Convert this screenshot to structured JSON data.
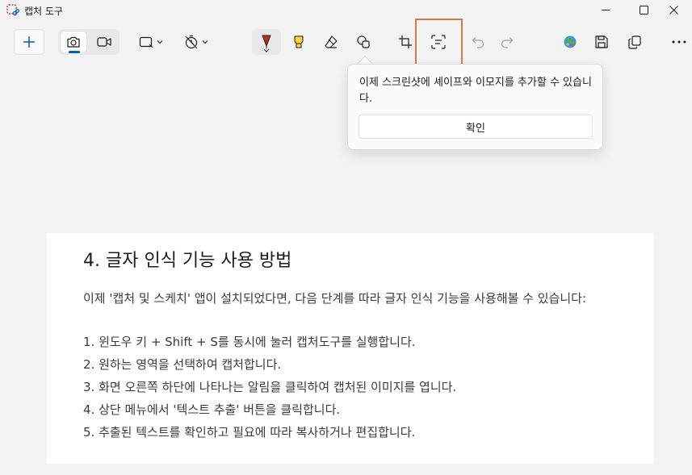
{
  "window": {
    "title": "캡처 도구"
  },
  "toolbar": {
    "buttons": [
      {
        "name": "new-icon"
      },
      {
        "name": "screenshot-mode-icon",
        "active": true
      },
      {
        "name": "video-mode-icon"
      },
      {
        "name": "rectangle-snip-icon"
      },
      {
        "name": "delay-timer-icon"
      },
      {
        "name": "ballpoint-pen-icon",
        "active": true
      },
      {
        "name": "highlighter-icon"
      },
      {
        "name": "eraser-icon"
      },
      {
        "name": "shapes-icon"
      },
      {
        "name": "crop-icon"
      },
      {
        "name": "text-actions-icon"
      },
      {
        "name": "undo-icon"
      },
      {
        "name": "redo-icon"
      },
      {
        "name": "paint-icon"
      },
      {
        "name": "save-icon"
      },
      {
        "name": "copy-icon"
      },
      {
        "name": "more-icon"
      }
    ],
    "highlight_color": "#d9774b",
    "accent_color": "#005fb8"
  },
  "popup": {
    "message": "이제 스크린샷에 셰이프와 이모지를 추가할 수 있습니다.",
    "confirm_label": "확인"
  },
  "document": {
    "title": "4. 글자 인식 기능 사용 방법",
    "intro": "이제 '캡처 및 스케치' 앱이 설치되었다면, 다음 단계를 따라 글자 인식 기능을 사용해볼 수 있습니다:",
    "steps": [
      "1. 윈도우 키 + Shift + S를 동시에 눌러 캡처도구를 실행합니다.",
      "2. 원하는 영역을 선택하여 캡처합니다.",
      "3. 화면 오른쪽 하단에 나타나는 알림을 클릭하여 캡처된 이미지를 엽니다.",
      "4. 상단 메뉴에서 '텍스트 추출' 버튼을 클릭합니다.",
      "5. 추출된 텍스트를 확인하고 필요에 따라 복사하거나 편집합니다."
    ]
  }
}
